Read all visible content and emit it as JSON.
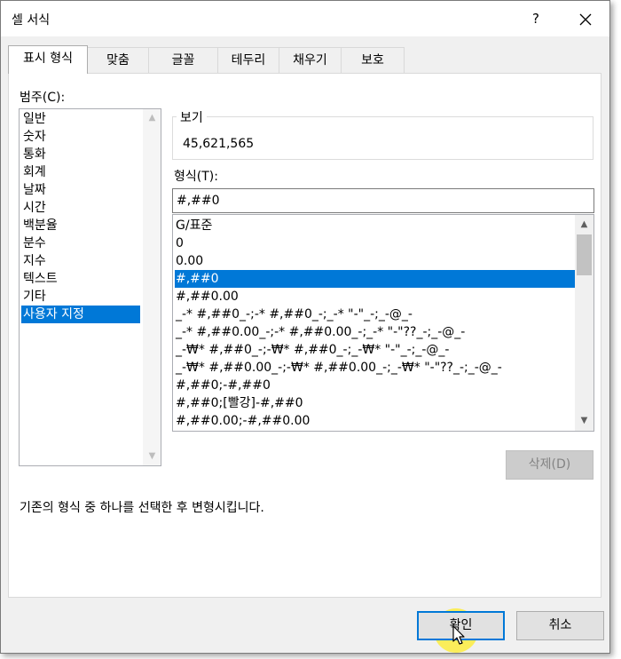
{
  "window": {
    "title": "셀 서식",
    "help": "?"
  },
  "tabs": [
    "표시 형식",
    "맞춤",
    "글꼴",
    "테두리",
    "채우기",
    "보호"
  ],
  "category": {
    "label": "범주(C):",
    "items": [
      "일반",
      "숫자",
      "통화",
      "회계",
      "날짜",
      "시간",
      "백분율",
      "분수",
      "지수",
      "텍스트",
      "기타",
      "사용자 지정"
    ],
    "selected": "사용자 지정"
  },
  "sample": {
    "label": "보기",
    "value": "45,621,565"
  },
  "format": {
    "label": "형식(T):",
    "value": "#,##0",
    "items": [
      "G/표준",
      "0",
      "0.00",
      "#,##0",
      "#,##0.00",
      "_-* #,##0_-;-* #,##0_-;_-* \"-\"_-;_-@_-",
      "_-* #,##0.00_-;-* #,##0.00_-;_-* \"-\"??_-;_-@_-",
      "_-₩* #,##0_-;-₩* #,##0_-;_-₩* \"-\"_-;_-@_-",
      "_-₩* #,##0.00_-;-₩* #,##0.00_-;_-₩* \"-\"??_-;_-@_-",
      "#,##0;-#,##0",
      "#,##0;[빨강]-#,##0",
      "#,##0.00;-#,##0.00"
    ],
    "selected": "#,##0"
  },
  "delete_button": "삭제(D)",
  "description": "기존의 형식 중 하나를 선택한 후 변형시킵니다.",
  "ok_button": "확인",
  "cancel_button": "취소",
  "colors": {
    "accent": "#0078d7",
    "highlight": "#ffec28"
  }
}
